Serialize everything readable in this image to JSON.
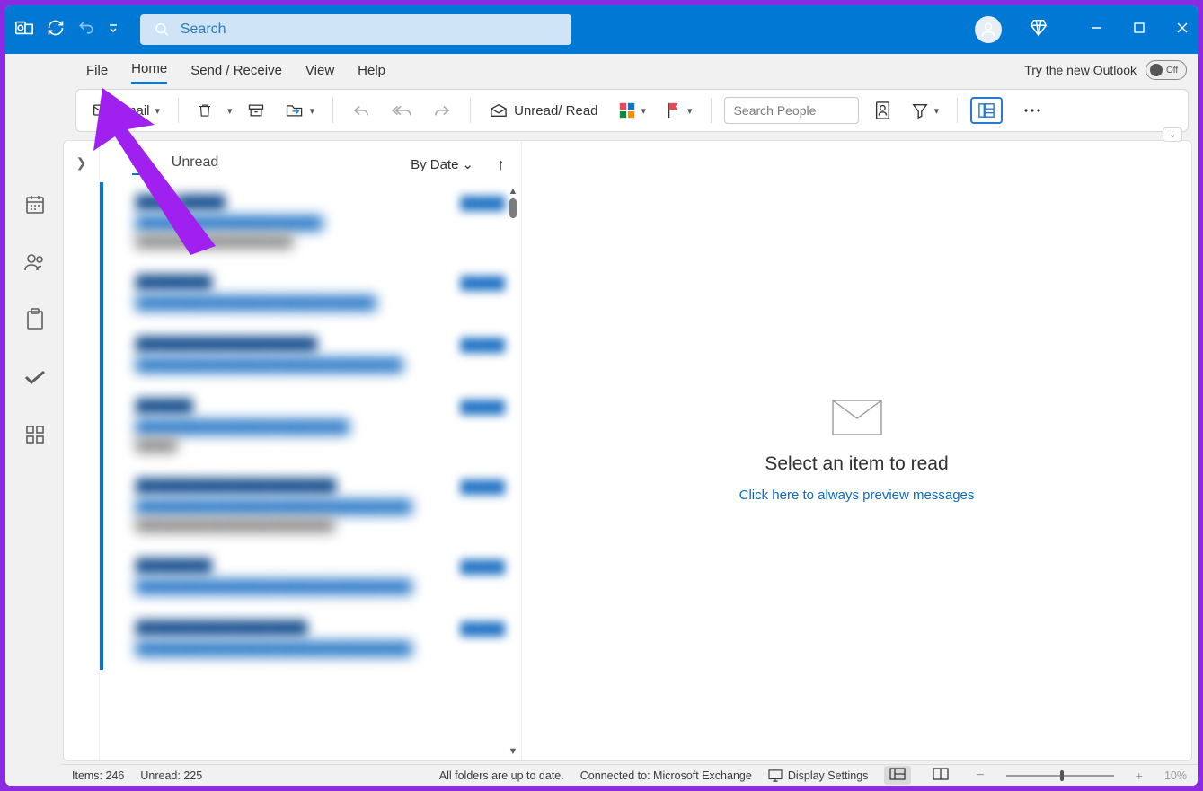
{
  "titlebar": {
    "search_placeholder": "Search"
  },
  "menu": {
    "file": "File",
    "home": "Home",
    "send_receive": "Send / Receive",
    "view": "View",
    "help": "Help",
    "try_new": "Try the new Outlook",
    "toggle_state": "Off"
  },
  "ribbon": {
    "new_email": "Email",
    "unread_read": "Unread/ Read",
    "search_people_placeholder": "Search People"
  },
  "msg_list": {
    "filter_all": "All",
    "filter_unread": "Unread",
    "sort_label": "By Date",
    "items": [
      {
        "from": "████ █████",
        "subject": "█████████████████████",
        "time": "█████",
        "preview": "███████████████████"
      },
      {
        "from": "████████",
        "subject": "███████████████████████████",
        "time": "█████",
        "preview": ""
      },
      {
        "from": "███████████████████",
        "subject": "██████████████████████████████",
        "time": "█████",
        "preview": ""
      },
      {
        "from": "██████",
        "subject": "████████████████████████",
        "time": "█████",
        "preview": "█████"
      },
      {
        "from": "█████████████████████",
        "subject": "███████████████████████████████",
        "time": "█████",
        "preview": "████████████████████████"
      },
      {
        "from": "████████",
        "subject": "███████████████████████████████",
        "time": "█████",
        "preview": ""
      },
      {
        "from": "██████████████████",
        "subject": "███████████████████████████████",
        "time": "█████",
        "preview": ""
      }
    ]
  },
  "reading_pane": {
    "title": "Select an item to read",
    "preview_link": "Click here to always preview messages"
  },
  "statusbar": {
    "items": "Items: 246",
    "unread": "Unread: 225",
    "sync": "All folders are up to date.",
    "connected": "Connected to: Microsoft Exchange",
    "display_settings": "Display Settings",
    "zoom": "10%"
  }
}
